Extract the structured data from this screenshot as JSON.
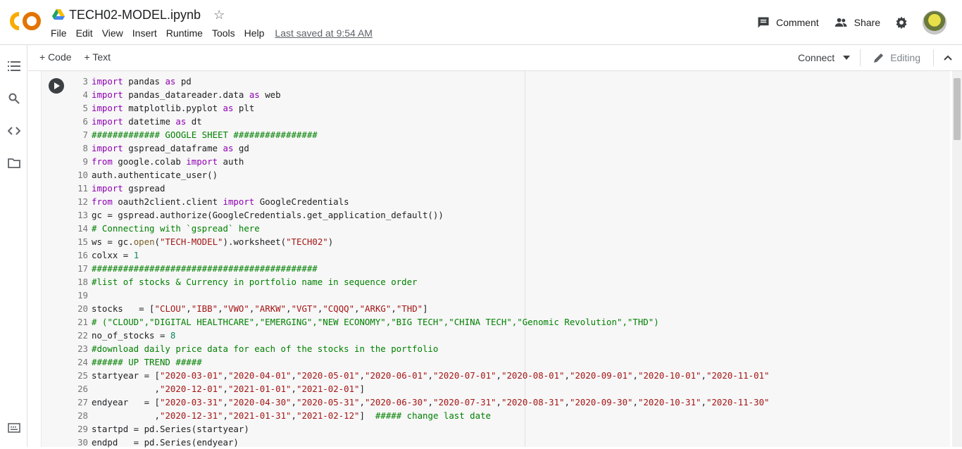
{
  "header": {
    "logo_text": "CO",
    "doc_title": "TECH02-MODEL.ipynb",
    "menu": [
      "File",
      "Edit",
      "View",
      "Insert",
      "Runtime",
      "Tools",
      "Help"
    ],
    "last_saved": "Last saved at 9:54 AM",
    "comment_label": "Comment",
    "share_label": "Share"
  },
  "toolbar": {
    "add_code": "+ Code",
    "add_text": "+ Text",
    "connect_label": "Connect",
    "editing_label": "Editing"
  },
  "sidebar": {
    "icons": [
      "table-of-contents-icon",
      "search-icon",
      "code-snippets-icon",
      "files-icon",
      "terminal-icon"
    ]
  },
  "code": {
    "lines": [
      {
        "n": "3",
        "text": "import pandas as pd"
      },
      {
        "n": "4",
        "text": "import pandas_datareader.data as web"
      },
      {
        "n": "5",
        "text": "import matplotlib.pyplot as plt"
      },
      {
        "n": "6",
        "text": "import datetime as dt"
      },
      {
        "n": "7",
        "text": "############# GOOGLE SHEET ################"
      },
      {
        "n": "8",
        "text": "import gspread_dataframe as gd"
      },
      {
        "n": "9",
        "text": "from google.colab import auth"
      },
      {
        "n": "10",
        "text": "auth.authenticate_user()"
      },
      {
        "n": "11",
        "text": "import gspread"
      },
      {
        "n": "12",
        "text": "from oauth2client.client import GoogleCredentials"
      },
      {
        "n": "13",
        "text": "gc = gspread.authorize(GoogleCredentials.get_application_default())"
      },
      {
        "n": "14",
        "text": "# Connecting with `gspread` here"
      },
      {
        "n": "15",
        "text": "ws = gc.open(\"TECH-MODEL\").worksheet(\"TECH02\")"
      },
      {
        "n": "16",
        "text": "colxx = 1"
      },
      {
        "n": "17",
        "text": "###########################################"
      },
      {
        "n": "18",
        "text": "#list of stocks & Currency in portfolio name in sequence order"
      },
      {
        "n": "19",
        "text": ""
      },
      {
        "n": "20",
        "text": "stocks   = [\"CLOU\",\"IBB\",\"VWO\",\"ARKW\",\"VGT\",\"CQQQ\",\"ARKG\",\"THD\"]"
      },
      {
        "n": "21",
        "text": "# (\"CLOUD\",\"DIGITAL HEALTHCARE\",\"EMERGING\",\"NEW ECONOMY\",\"BIG TECH\",\"CHINA TECH\",\"Genomic Revolution\",\"THD\")"
      },
      {
        "n": "22",
        "text": "no_of_stocks = 8"
      },
      {
        "n": "23",
        "text": "#download daily price data for each of the stocks in the portfolio"
      },
      {
        "n": "24",
        "text": "###### UP TREND #####"
      },
      {
        "n": "25",
        "text": "startyear = [\"2020-03-01\",\"2020-04-01\",\"2020-05-01\",\"2020-06-01\",\"2020-07-01\",\"2020-08-01\",\"2020-09-01\",\"2020-10-01\",\"2020-11-01\""
      },
      {
        "n": "26",
        "text": "            ,\"2020-12-01\",\"2021-01-01\",\"2021-02-01\"]"
      },
      {
        "n": "27",
        "text": "endyear   = [\"2020-03-31\",\"2020-04-30\",\"2020-05-31\",\"2020-06-30\",\"2020-07-31\",\"2020-08-31\",\"2020-09-30\",\"2020-10-31\",\"2020-11-30\""
      },
      {
        "n": "28",
        "text": "            ,\"2020-12-31\",\"2021-01-31\",\"2021-02-12\"]  ##### change last date"
      },
      {
        "n": "29",
        "text": "startpd = pd.Series(startyear)"
      },
      {
        "n": "30",
        "text": "endpd   = pd.Series(endyear)"
      }
    ]
  },
  "colors": {
    "logo_orange": "#f9ab00",
    "logo_dark_orange": "#e37400",
    "keyword": "#8f00b2",
    "string": "#a31515",
    "comment": "#008000"
  }
}
